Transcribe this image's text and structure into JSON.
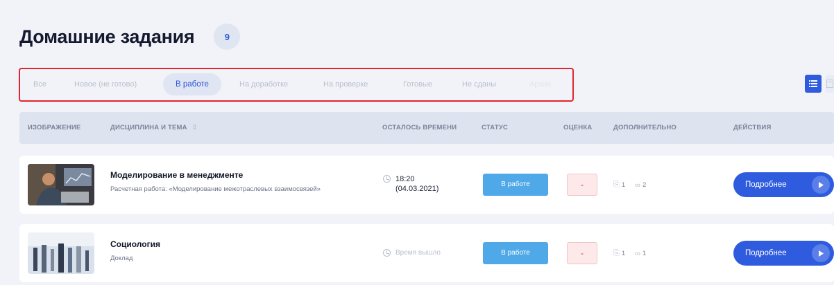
{
  "page": {
    "title": "Домашние задания",
    "count": "9"
  },
  "filters": [
    {
      "label": "Все",
      "state": "inactive"
    },
    {
      "label": "Новое (не готово)",
      "state": "inactive"
    },
    {
      "label": "В работе",
      "state": "active"
    },
    {
      "label": "На доработке",
      "state": "inactive"
    },
    {
      "label": "На проверке",
      "state": "inactive"
    },
    {
      "label": "Готовые",
      "state": "inactive"
    },
    {
      "label": "Не сданы",
      "state": "inactive"
    },
    {
      "label": "Архив",
      "state": "faded"
    }
  ],
  "view_toggle": {
    "list_icon": "list-view-icon",
    "grid_icon": "grid-view-icon",
    "active": "list"
  },
  "table": {
    "headers": {
      "image": "ИЗОБРАЖЕНИЕ",
      "discipline": "ДИСЦИПЛИНА И ТЕМА",
      "time_left": "ОСТАЛОСЬ ВРЕМЕНИ",
      "status": "СТАТУС",
      "grade": "ОЦЕНКА",
      "extra": "ДОПОЛНИТЕЛЬНО",
      "actions": "ДЕЙСТВИЯ"
    },
    "rows": [
      {
        "subject": "Моделирование в менеджменте",
        "topic": "Расчетная работа: «Моделирование межотраслевых взаимосвязей»",
        "time": "18:20",
        "date": "(04.03.2021)",
        "status": "В работе",
        "grade": "-",
        "files": "1",
        "links": "2",
        "action": "Подробнее"
      },
      {
        "subject": "Социология",
        "topic": "Доклад",
        "time_expired": "Время вышло",
        "status": "В работе",
        "grade": "-",
        "files": "1",
        "links": "1",
        "action": "Подробнее"
      }
    ]
  },
  "colors": {
    "accent": "#2f5bde",
    "status": "#4fa8e8",
    "grade_bg": "#fde9ea",
    "highlight_border": "#e0252e",
    "background": "#f1f3f8"
  }
}
